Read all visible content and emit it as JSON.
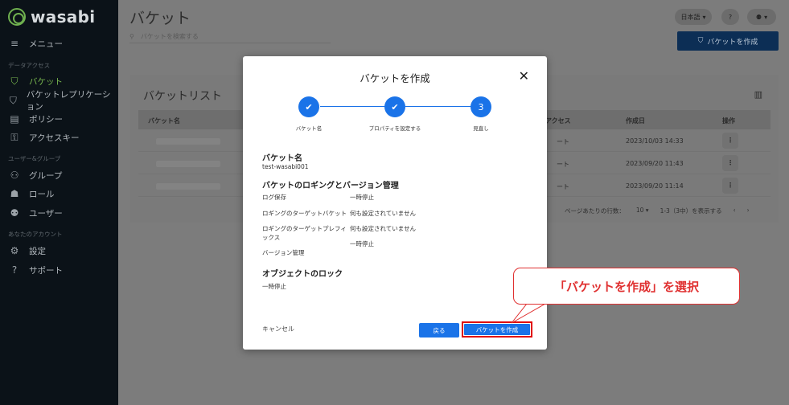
{
  "brand": {
    "name": "wasabi"
  },
  "sidebar": {
    "menu_label": "メニュー",
    "sections": [
      "データアクセス",
      "ユーザー&グループ",
      "あなたのアカウント"
    ],
    "items": [
      {
        "label": "バケット",
        "icon": "bucket-icon",
        "active": true
      },
      {
        "label": "バケットレプリケーション",
        "icon": "replication-icon"
      },
      {
        "label": "ポリシー",
        "icon": "policy-icon"
      },
      {
        "label": "アクセスキー",
        "icon": "key-icon"
      },
      {
        "label": "グループ",
        "icon": "group-icon"
      },
      {
        "label": "ロール",
        "icon": "role-icon"
      },
      {
        "label": "ユーザー",
        "icon": "user-icon"
      },
      {
        "label": "設定",
        "icon": "gear-icon"
      },
      {
        "label": "サポート",
        "icon": "help-icon"
      }
    ]
  },
  "header": {
    "title": "バケット",
    "search_placeholder": "バケットを検索する",
    "language": "日本語",
    "create_button": "バケットを作成"
  },
  "bucket_list": {
    "title": "バケットリスト",
    "columns": [
      "バケット名",
      "アクセス",
      "作成日",
      "操作"
    ],
    "rows": [
      {
        "access": "ート",
        "date": "2023/10/03 14:33"
      },
      {
        "access": "ート",
        "date": "2023/09/20 11:43"
      },
      {
        "access": "ート",
        "date": "2023/09/20 11:14"
      }
    ],
    "rows_per_page_label": "ページあたりの行数：",
    "rows_per_page": "10",
    "range": "1-3（3中）を表示する"
  },
  "modal": {
    "title": "バケットを作成",
    "steps": [
      {
        "label": "バケット名",
        "state": "done"
      },
      {
        "label": "プロパティを設定する",
        "state": "done"
      },
      {
        "label": "見直し",
        "number": "3",
        "state": "current"
      }
    ],
    "bucket_name_heading": "バケット名",
    "bucket_name_value": "test-wasabi001",
    "logging_heading": "バケットのロギングとバージョン管理",
    "fields": [
      {
        "key": "ログ保存",
        "value": "一時停止"
      },
      {
        "key": "ロギングのターゲットバケット",
        "value": "何も設定されていません"
      },
      {
        "key": "ロギングのターゲットプレフィックス",
        "value": "何も設定されていません"
      },
      {
        "key": "バージョン管理",
        "value": "一時停止"
      }
    ],
    "lock_heading": "オブジェクトのロック",
    "lock_value": "一時停止",
    "cancel_label": "キャンセル",
    "back_label": "戻る",
    "create_label": "バケットを作成"
  },
  "callout": {
    "text": "「バケットを作成」を選択"
  },
  "colors": {
    "accent": "#1a73e8",
    "brand_green": "#6fb04f",
    "highlight": "#e00000"
  }
}
